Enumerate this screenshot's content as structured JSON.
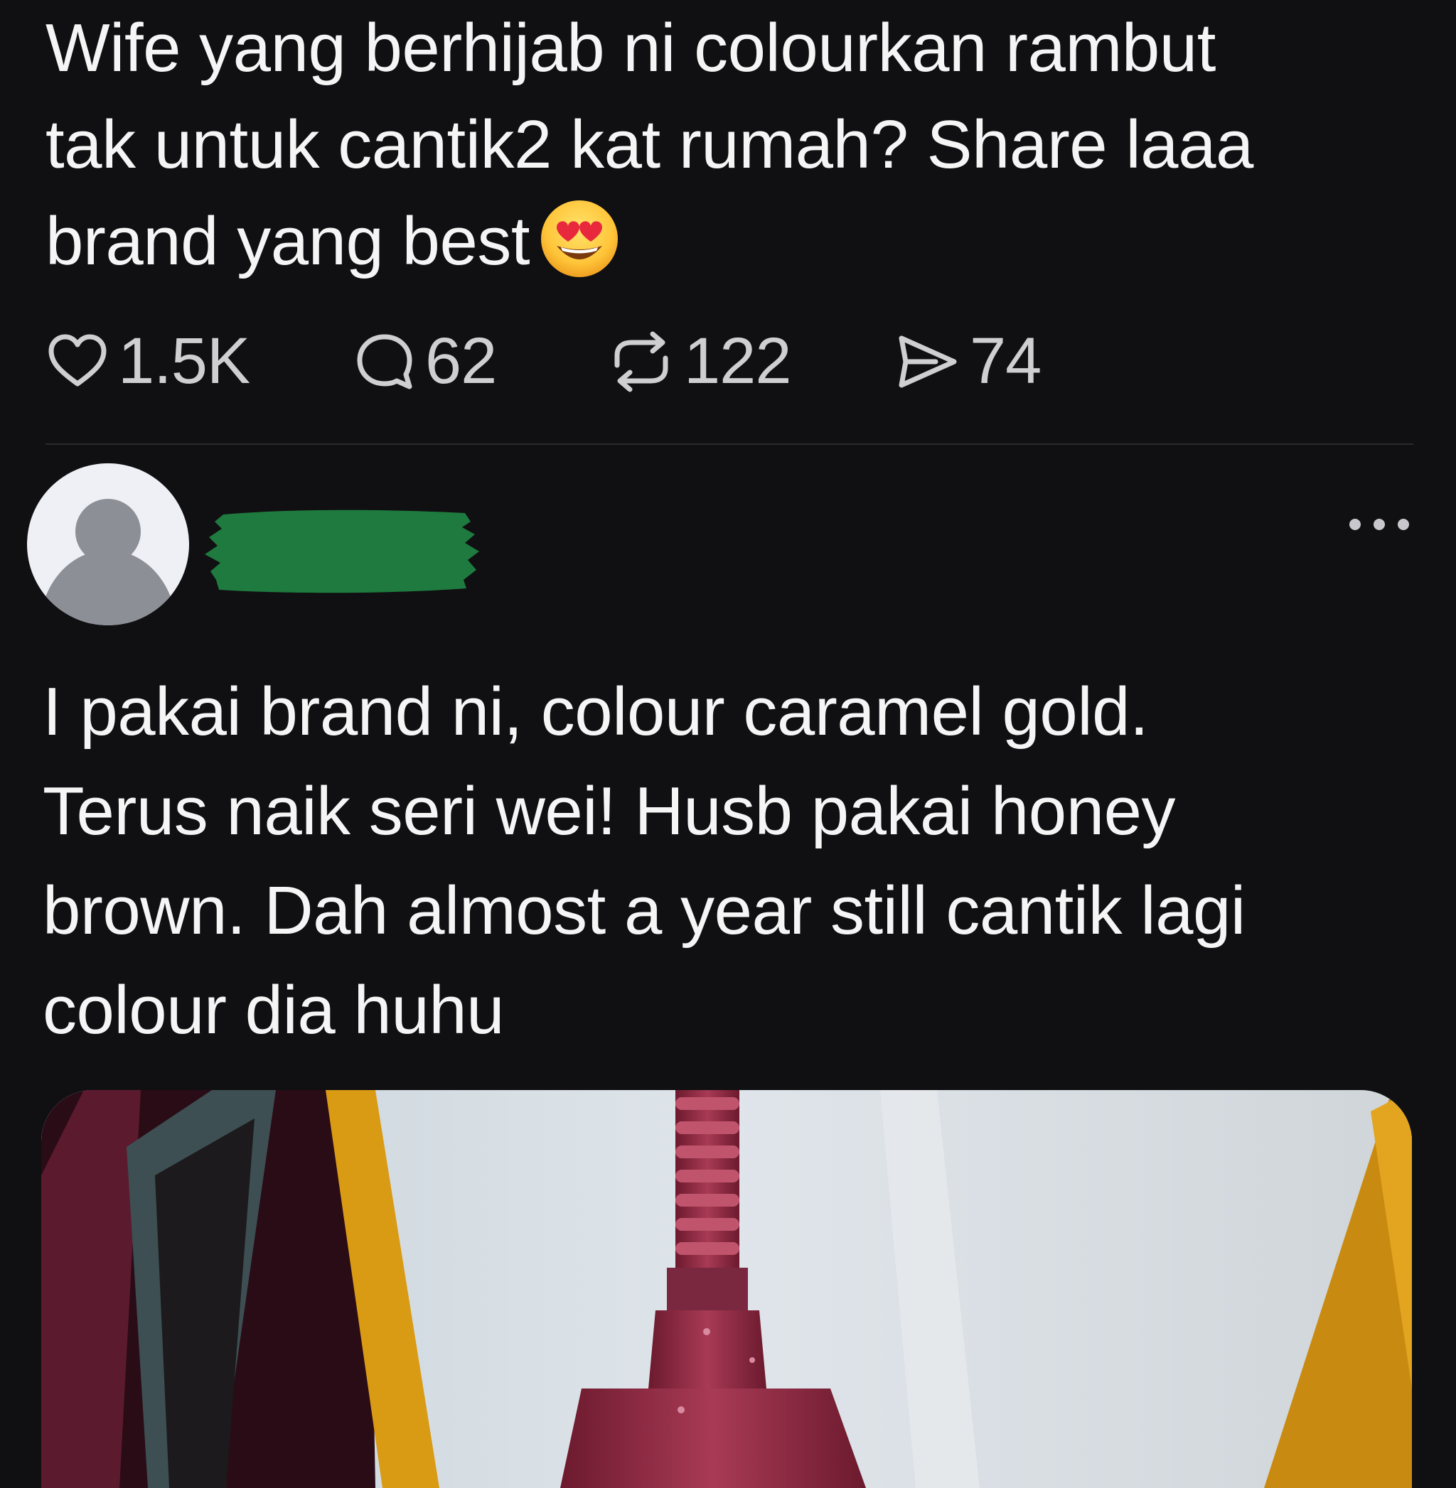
{
  "post": {
    "text_lines": [
      "Wife yang berhijab ni colourkan rambut",
      "tak untuk cantik2 kat rumah? Share laaa",
      "brand yang best"
    ],
    "emoji": "heart-eyes-emoji"
  },
  "actions": {
    "likes": "1.5K",
    "replies": "62",
    "reposts": "122",
    "shares": "74"
  },
  "reply": {
    "avatar_icon": "default-avatar-icon",
    "more_icon": "more-options-icon",
    "text_lines": [
      "I pakai brand ni, colour caramel gold.",
      "Terus naik seri wei! Husb pakai honey",
      "brown. Dah almost a year still cantik lagi",
      "colour dia huhu"
    ]
  },
  "colors": {
    "background": "#101012",
    "text": "#f5f5f5",
    "redaction": "#1e7a3e"
  }
}
